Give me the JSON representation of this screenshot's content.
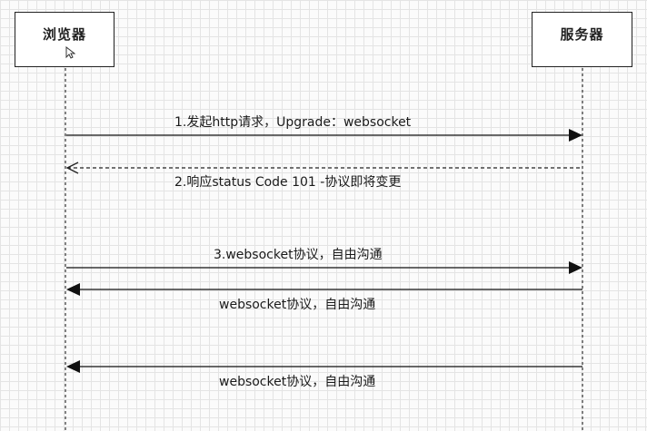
{
  "actors": {
    "browser": "浏览器",
    "server": "服务器"
  },
  "messages": [
    {
      "label": "1.发起http请求，Upgrade：websocket",
      "direction": "right",
      "style": "solid"
    },
    {
      "label": "2.响应status Code 101 -协议即将变更",
      "direction": "left",
      "style": "dashed"
    },
    {
      "label": "3.websocket协议，自由沟通",
      "direction": "right",
      "style": "solid"
    },
    {
      "label": "websocket协议，自由沟通",
      "direction": "left",
      "style": "solid"
    },
    {
      "label": "websocket协议，自由沟通",
      "direction": "left",
      "style": "solid"
    }
  ]
}
